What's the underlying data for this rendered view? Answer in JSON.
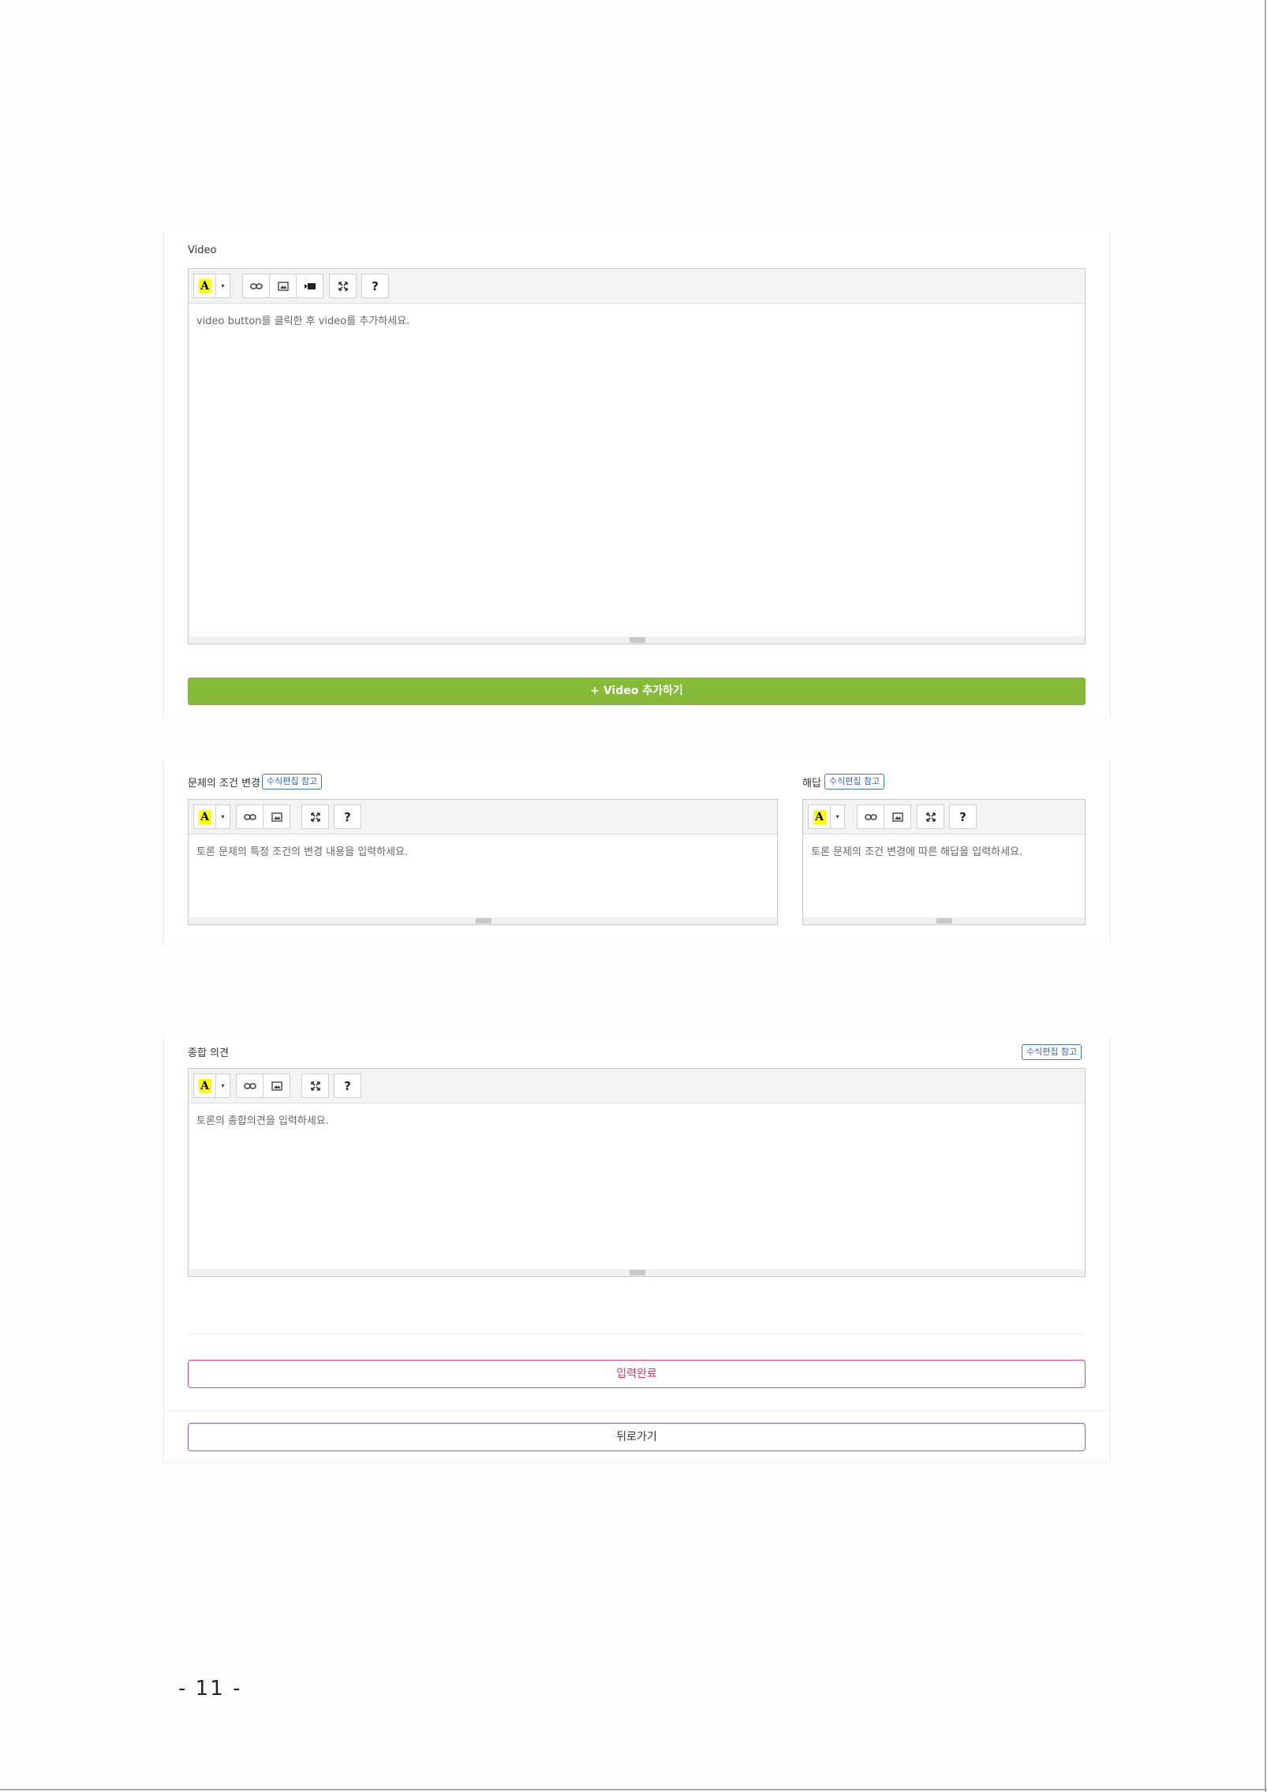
{
  "toolbar": {
    "font_color_glyph": "A",
    "caret": "▾",
    "help": "?"
  },
  "video_section": {
    "label": "Video",
    "placeholder": "video button를 클릭한 후 video를 추가하세요.",
    "add_button": "+ Video 추가하기"
  },
  "condition_section": {
    "label": "문제의 조건 변경",
    "ref_badge": "수식편집 참고",
    "placeholder": "토론 문제의 특정 조건의 변경 내용을 입력하세요."
  },
  "answer_section": {
    "label": "해답",
    "ref_badge": "수식편집 참고",
    "placeholder": "토론 문제의 조건 변경에 따른 해답을 입력하세요."
  },
  "summary_section": {
    "label": "종합 의견",
    "ref_badge": "수식편집 참고",
    "placeholder": "토론의 종합의견을 입력하세요."
  },
  "actions": {
    "submit": "입력완료",
    "back": "뒤로가기"
  },
  "page_number": "- 11 -",
  "colors": {
    "accent_green": "#86bb3a",
    "submit_border": "#e9407a",
    "back_border": "#8a5fd6",
    "ref_badge": "#2f63d3",
    "highlight_yellow": "#ffff00"
  }
}
